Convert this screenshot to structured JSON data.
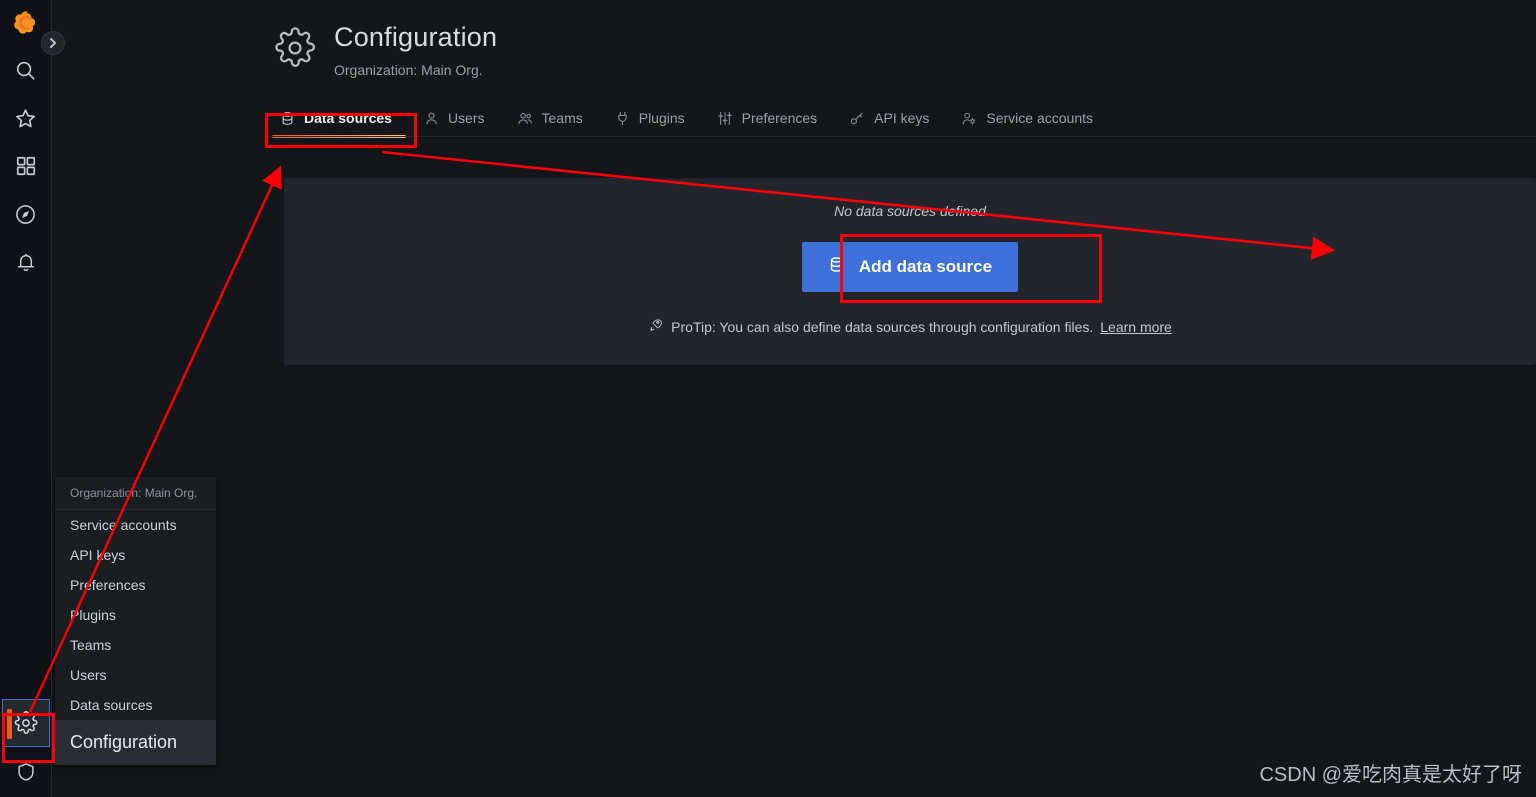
{
  "app": {
    "name": "Grafana"
  },
  "sidebar": {
    "items": [
      {
        "name": "grafana-logo",
        "label": "Grafana"
      },
      {
        "name": "search",
        "label": "Search"
      },
      {
        "name": "starred",
        "label": "Starred"
      },
      {
        "name": "dashboards",
        "label": "Dashboards"
      },
      {
        "name": "explore",
        "label": "Explore"
      },
      {
        "name": "alerting",
        "label": "Alerting"
      }
    ],
    "bottom_items": [
      {
        "name": "configuration",
        "label": "Configuration",
        "active": true
      },
      {
        "name": "shield",
        "label": "Server Admin"
      }
    ],
    "collapse_label": "›"
  },
  "flyout": {
    "header": "Organization: Main Org.",
    "items": [
      {
        "label": "Service accounts"
      },
      {
        "label": "API keys"
      },
      {
        "label": "Preferences"
      },
      {
        "label": "Plugins"
      },
      {
        "label": "Teams"
      },
      {
        "label": "Users"
      },
      {
        "label": "Data sources"
      }
    ],
    "section_label": "Configuration"
  },
  "header": {
    "title": "Configuration",
    "subtitle": "Organization: Main Org.",
    "icon": "gear-icon"
  },
  "tabs": [
    {
      "label": "Data sources",
      "icon": "database-icon",
      "active": true
    },
    {
      "label": "Users",
      "icon": "user-icon",
      "active": false
    },
    {
      "label": "Teams",
      "icon": "users-icon",
      "active": false
    },
    {
      "label": "Plugins",
      "icon": "plug-icon",
      "active": false
    },
    {
      "label": "Preferences",
      "icon": "sliders-icon",
      "active": false
    },
    {
      "label": "API keys",
      "icon": "key-icon",
      "active": false
    },
    {
      "label": "Service accounts",
      "icon": "user-gear-icon",
      "active": false
    }
  ],
  "main": {
    "empty_message": "No data sources defined",
    "add_button_label": "Add data source",
    "protip_prefix": "ProTip: You can also define data sources through configuration files.",
    "protip_link": "Learn more"
  },
  "colors": {
    "accent_blue": "#3d71d9",
    "accent_orange": "#f05a28",
    "annotation_red": "#fb0007",
    "panel_bg": "#22252b",
    "page_bg": "#141619"
  },
  "watermark": "CSDN @爱吃肉真是太好了呀"
}
